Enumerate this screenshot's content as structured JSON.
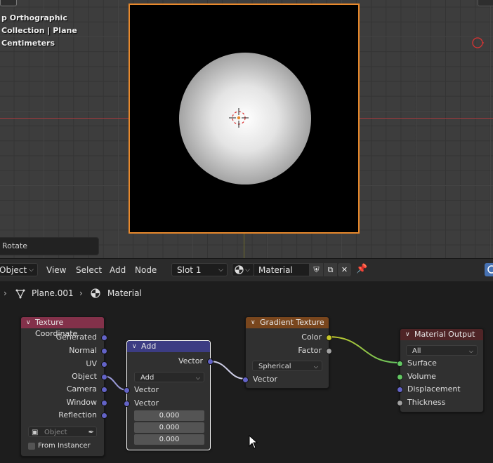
{
  "viewport": {
    "info_lines": [
      "p Orthographic",
      "Collection | Plane",
      "Centimeters"
    ],
    "operator_panel": "Rotate"
  },
  "header": {
    "mode_label": "Object",
    "menus": [
      "View",
      "Select",
      "Add",
      "Node"
    ],
    "slot_label": "Slot 1",
    "material_name": "Material"
  },
  "breadcrumb": {
    "object_name": "Plane.001",
    "material_name": "Material"
  },
  "nodes": {
    "texture_coordinate": {
      "title": "Texture Coordinate",
      "outputs": [
        "Generated",
        "Normal",
        "UV",
        "Object",
        "Camera",
        "Window",
        "Reflection"
      ],
      "object_placeholder": "Object",
      "from_instancer_label": "From Instancer"
    },
    "add": {
      "title": "Add",
      "output": "Vector",
      "operation": "Add",
      "inputs": [
        "Vector",
        "Vector"
      ],
      "values": [
        "0.000",
        "0.000",
        "0.000"
      ]
    },
    "gradient_texture": {
      "title": "Gradient Texture",
      "outputs": [
        "Color",
        "Factor"
      ],
      "type": "Spherical",
      "input": "Vector"
    },
    "material_output": {
      "title": "Material Output",
      "target": "All",
      "inputs": [
        "Surface",
        "Volume",
        "Displacement",
        "Thickness"
      ]
    }
  },
  "colors": {
    "selection_orange": "#e8892c",
    "input_node_header": "#83314a",
    "vector_node_header": "#3c3c83",
    "texture_node_header": "#79461d",
    "output_node_header": "#4f2426",
    "vector_socket": "#6363c7",
    "color_socket": "#c7c729",
    "float_socket": "#a1a1a1",
    "shader_socket": "#63c763"
  }
}
